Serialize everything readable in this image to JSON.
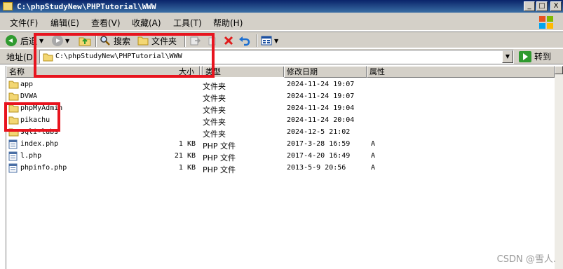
{
  "window": {
    "title": "C:\\phpStudyNew\\PHPTutorial\\WWW",
    "controls": [
      "_",
      "□",
      "X"
    ]
  },
  "menu": [
    "文件(F)",
    "编辑(E)",
    "查看(V)",
    "收藏(A)",
    "工具(T)",
    "帮助(H)"
  ],
  "toolbar": {
    "back_label": "后退",
    "search_label": "搜索",
    "folders_label": "文件夹"
  },
  "address": {
    "label": "地址(D)",
    "value": "C:\\phpStudyNew\\PHPTutorial\\WWW",
    "go_label": "转到"
  },
  "columns": [
    "名称",
    "大小",
    "类型",
    "修改日期",
    "属性"
  ],
  "files": [
    {
      "name": "app",
      "size": "",
      "type": "文件夹",
      "modified": "2024-11-24 19:07",
      "attr": "",
      "icon": "folder-icon"
    },
    {
      "name": "DVWA",
      "size": "",
      "type": "文件夹",
      "modified": "2024-11-24 19:07",
      "attr": "",
      "icon": "folder-icon"
    },
    {
      "name": "phpMyAdmin",
      "size": "",
      "type": "文件夹",
      "modified": "2024-11-24 19:04",
      "attr": "",
      "icon": "folder-icon"
    },
    {
      "name": "pikachu",
      "size": "",
      "type": "文件夹",
      "modified": "2024-11-24 20:04",
      "attr": "",
      "icon": "folder-icon"
    },
    {
      "name": "sqli-labs",
      "size": "",
      "type": "文件夹",
      "modified": "2024-12-5 21:02",
      "attr": "",
      "icon": "folder-icon"
    },
    {
      "name": "index.php",
      "size": "1 KB",
      "type": "PHP 文件",
      "modified": "2017-3-28 16:59",
      "attr": "A",
      "icon": "php-file-icon"
    },
    {
      "name": "l.php",
      "size": "21 KB",
      "type": "PHP 文件",
      "modified": "2017-4-20 16:49",
      "attr": "A",
      "icon": "php-file-icon"
    },
    {
      "name": "phpinfo.php",
      "size": "1 KB",
      "type": "PHP 文件",
      "modified": "2013-5-9 20:56",
      "attr": "A",
      "icon": "php-file-icon"
    }
  ],
  "watermark": "CSDN @雪人.",
  "colors": {
    "titlebar": "#0a246a",
    "chrome": "#d4d0c8",
    "annotation": "#e8141e",
    "folder": "#f3d774"
  }
}
